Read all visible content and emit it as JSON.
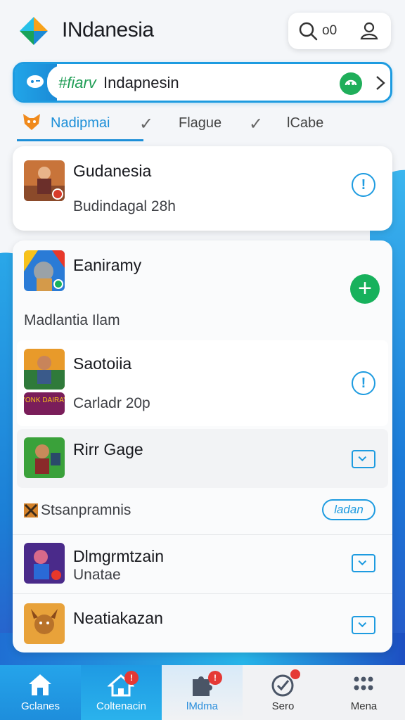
{
  "app": {
    "title": "INdanesia"
  },
  "header": {
    "tool_text": "o0"
  },
  "search": {
    "hash": "#fiarv",
    "query": "Indapnesin"
  },
  "tabs": [
    {
      "label": "Nadipmai"
    },
    {
      "label": "Flague"
    },
    {
      "label": "lCabe"
    }
  ],
  "card1": {
    "title": "Gudanesia",
    "subtitle": "Budindagal 28h"
  },
  "card2": {
    "title": "Eaniramy",
    "section_label": "Madlantia Ilam",
    "rows": [
      {
        "title": "Saotoiia",
        "subtitle": "Carladr 20p",
        "thumb_badge": "YONK DAIRAY"
      },
      {
        "title": "Rirr Gage"
      }
    ],
    "group": {
      "label": "Stsanpramnis",
      "tag": "ladan"
    },
    "items": [
      {
        "title": "Dlmgrmtzain",
        "subtitle": "Unatae"
      },
      {
        "title": "Neatiakazan"
      }
    ]
  },
  "bottom_nav": [
    {
      "label": "Gclanes",
      "icon": "home-icon"
    },
    {
      "label": "Coltenacin",
      "icon": "home-badge-icon",
      "badge": "!"
    },
    {
      "label": "lMdma",
      "icon": "puzzle-icon",
      "badge": "!"
    },
    {
      "label": "Sero",
      "icon": "gauge-icon",
      "badge": ""
    },
    {
      "label": "Mena",
      "icon": "grid-icon"
    }
  ],
  "colors": {
    "accent": "#1d9be0",
    "green": "#17b15c",
    "badge_red": "#e53935"
  }
}
